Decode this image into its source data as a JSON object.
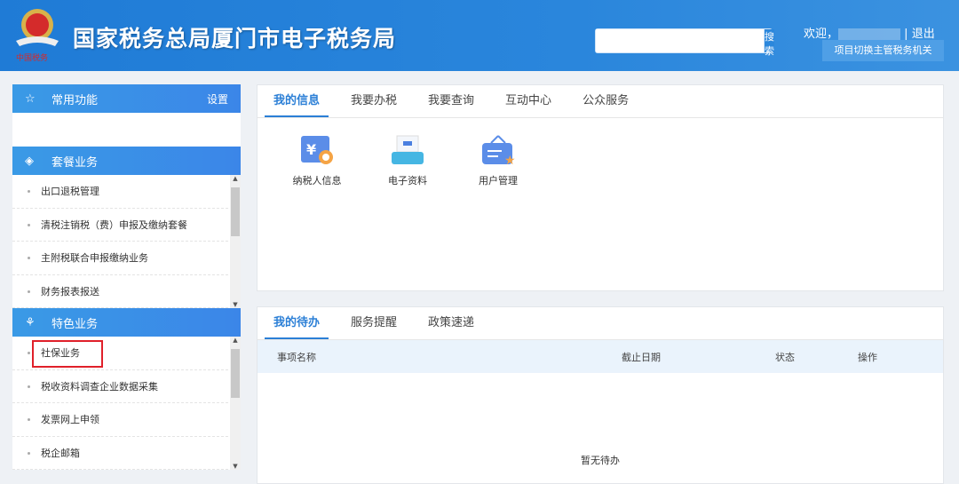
{
  "header": {
    "title": "国家税务总局厦门市电子税务局",
    "logo_text": "中国税务",
    "search_placeholder": "",
    "search_button": "搜索",
    "welcome": "欢迎，",
    "separator": "|",
    "logout": "退出",
    "switch_button": "项目切换主管税务机关"
  },
  "sidebar": {
    "common": {
      "title": "常用功能",
      "settings": "设置"
    },
    "package": {
      "title": "套餐业务",
      "items": [
        "出口退税管理",
        "清税注销税（费）申报及缴纳套餐",
        "主附税联合申报缴纳业务",
        "财务报表报送"
      ]
    },
    "special": {
      "title": "特色业务",
      "items": [
        "社保业务",
        "税收资料调查企业数据采集",
        "发票网上申领",
        "税企邮箱"
      ]
    }
  },
  "info_panel": {
    "tabs": [
      "我的信息",
      "我要办税",
      "我要查询",
      "互动中心",
      "公众服务"
    ],
    "apps": [
      "纳税人信息",
      "电子资料",
      "用户管理"
    ]
  },
  "todo_panel": {
    "tabs": [
      "我的待办",
      "服务提醒",
      "政策速递"
    ],
    "columns": [
      "事项名称",
      "截止日期",
      "状态",
      "操作"
    ],
    "empty": "暂无待办"
  }
}
